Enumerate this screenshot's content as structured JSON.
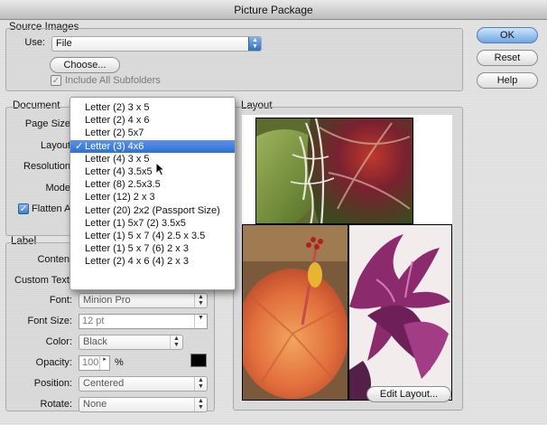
{
  "window": {
    "title": "Picture Package"
  },
  "buttons": {
    "ok": "OK",
    "reset": "Reset",
    "help": "Help",
    "choose": "Choose...",
    "edit_layout": "Edit Layout..."
  },
  "source": {
    "group_label": "Source Images",
    "use_label": "Use:",
    "use_value": "File",
    "include_subfolders": "Include All Subfolders"
  },
  "document": {
    "group_label": "Document",
    "page_size_label": "Page Size",
    "layout_label": "Layout",
    "resolution_label": "Resolution",
    "mode_label": "Mode",
    "flatten_label": "Flatten A"
  },
  "layout_menu": {
    "selected_index": 2,
    "items": [
      "Letter (2) 3 x 5",
      "Letter (2) 4 x 6",
      "Letter (2) 5x7",
      "Letter (3) 4x6",
      "Letter (4) 3 x 5",
      "Letter (4) 3.5x5",
      "Letter (8) 2.5x3.5",
      "Letter (12) 2 x 3",
      "Letter (20) 2x2 (Passport Size)",
      "Letter (1) 5x7 (2) 3.5x5",
      "Letter (1) 5 x 7 (4) 2.5 x 3.5",
      "Letter (1) 5 x 7 (6) 2 x 3",
      "Letter (2) 4 x 6 (4) 2 x 3"
    ]
  },
  "label": {
    "group_label": "Label",
    "content_label": "Content",
    "custom_text_label": "Custom Text:",
    "font_label": "Font:",
    "font_value": "Minion Pro",
    "font_size_label": "Font Size:",
    "font_size_value": "12 pt",
    "color_label": "Color:",
    "color_value": "Black",
    "color_swatch": "#000000",
    "opacity_label": "Opacity:",
    "opacity_value": "100",
    "opacity_unit": "%",
    "position_label": "Position:",
    "position_value": "Centered",
    "rotate_label": "Rotate:",
    "rotate_value": "None"
  },
  "layout_panel": {
    "group_label": "Layout"
  }
}
